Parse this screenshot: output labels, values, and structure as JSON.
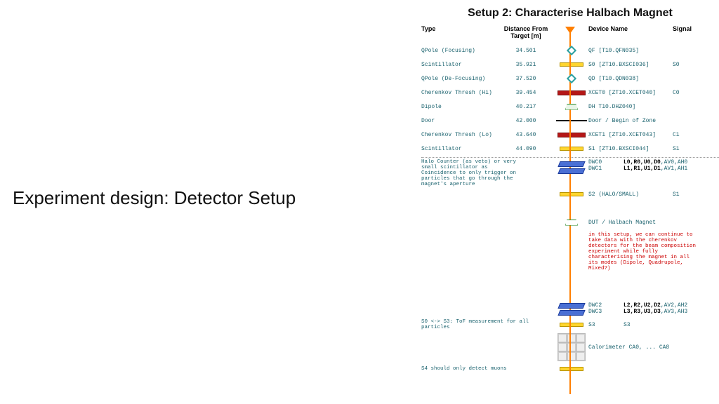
{
  "slide": {
    "title": "Experiment design: Detector Setup"
  },
  "setup": {
    "title": "Setup 2: Characterise Halbach Magnet",
    "headers": {
      "type": "Type",
      "distance": "Distance From Target [m]",
      "device": "Device Name",
      "signal": "Signal"
    },
    "rows": [
      {
        "type": "QPole (Focusing)",
        "dist": "34.501",
        "dev": "QF [T10.QFN035]",
        "sig": "",
        "shape": "diamond"
      },
      {
        "type": "Scintillator",
        "dist": "35.921",
        "dev": "S0 [ZT10.BXSCI036]",
        "sig": "S0",
        "shape": "bar-yellow"
      },
      {
        "type": "QPole (De-Focusing)",
        "dist": "37.520",
        "dev": "QD [T10.QDN038]",
        "sig": "",
        "shape": "diamond"
      },
      {
        "type": "Cherenkov Thresh (Hi)",
        "dist": "39.454",
        "dev": "XCET0 [ZT10.XCET040]",
        "sig": "C0",
        "shape": "bar-red"
      },
      {
        "type": "Dipole",
        "dist": "40.217",
        "dev": "DH T10.DHZ040]",
        "sig": "",
        "shape": "trap"
      },
      {
        "type": "Door",
        "dist": "42.000",
        "dev": "Door / Begin of Zone",
        "sig": "",
        "shape": "doorline"
      },
      {
        "type": "Cherenkov Thresh (Lo)",
        "dist": "43.640",
        "dev": "XCET1 [ZT10.XCET043]",
        "sig": "C1",
        "shape": "bar-red"
      },
      {
        "type": "Scintillator",
        "dist": "44.090",
        "dev": "S1 [ZT10.BXSCI044]",
        "sig": "S1",
        "shape": "bar-yellow"
      }
    ],
    "halo": {
      "note": "Halo Counter (as veto) or very small scintillator as Coincidence to only trigger on particles that go through the magnet's aperture",
      "dwc0": "DWC0",
      "dwc0sig": "L0,R0,U0,D0,AV0,AH0",
      "dwc1": "DWC1",
      "dwc1sig": "L1,R1,U1,D1,AV1,AH1"
    },
    "s2": {
      "dev": "S2 (HALO/SMALL)",
      "sig": "S1"
    },
    "dut": {
      "dev": "DUT / Halbach Magnet"
    },
    "rednote": "in this setup, we can continue to take data with the cherenkov detectors for the beam composition experiment while fully characterising the magnet in all its modes (Dipole, Quadrupole, Mixed?)",
    "dwc23": {
      "dwc2": "DWC2",
      "dwc2sig": "L2,R2,U2,D2,AV2,AH2",
      "dwc3": "DWC3",
      "dwc3sig": "L3,R3,U3,D3,AV3,AH3"
    },
    "tof": {
      "note": "S0 <-> S3: ToF measurement for all particles",
      "dev": "S3",
      "sig": "S3"
    },
    "calo": {
      "dev": "Calorimeter CA0, ... CA8"
    },
    "s4": {
      "note": "S4 should only detect muons"
    }
  }
}
